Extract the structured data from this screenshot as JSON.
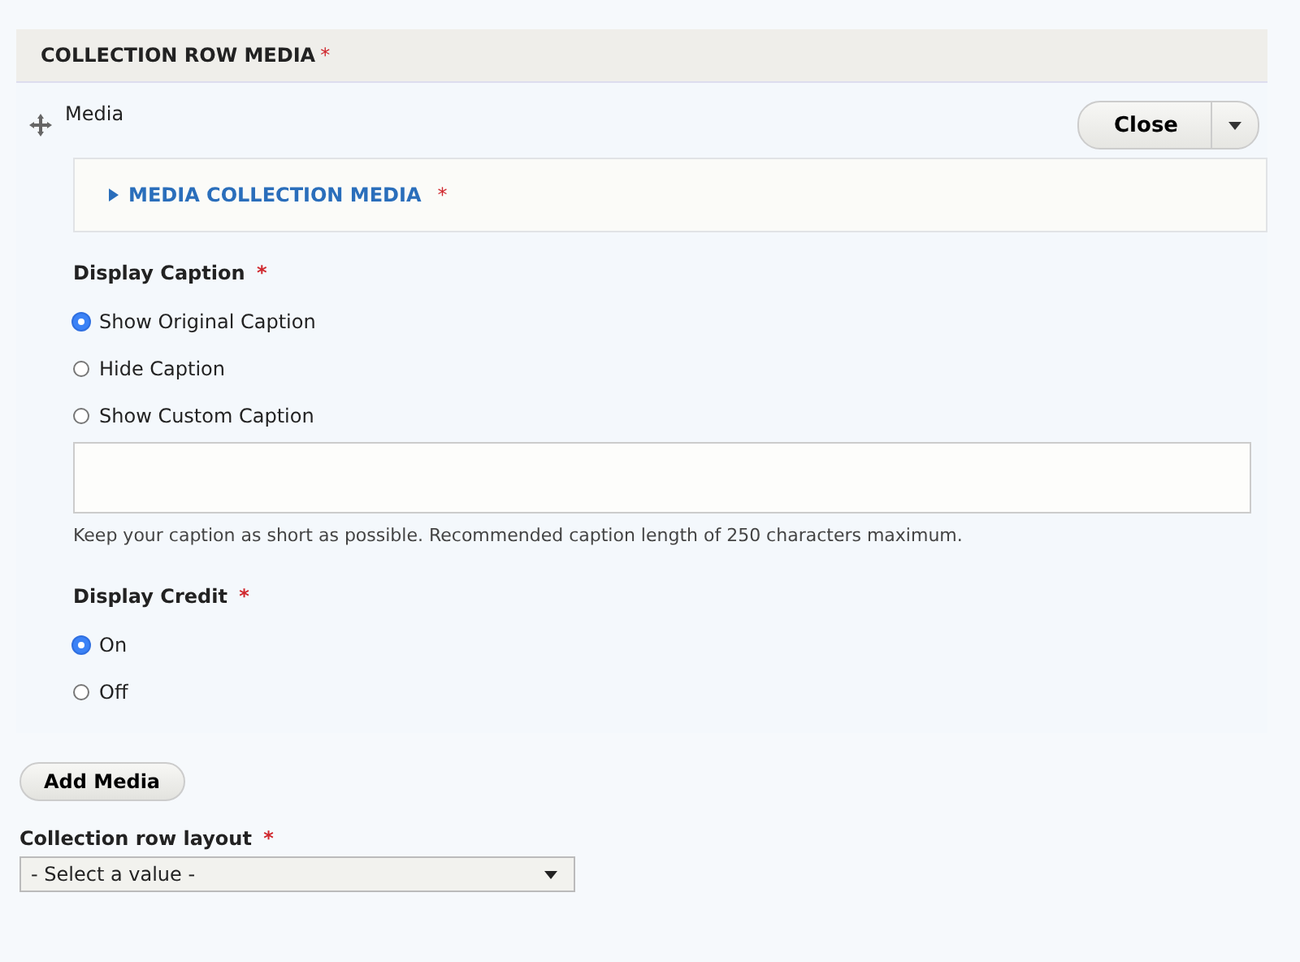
{
  "section": {
    "title": "COLLECTION ROW MEDIA",
    "required_mark": "*"
  },
  "item": {
    "label": "Media",
    "close_button": "Close",
    "details": {
      "title": "MEDIA COLLECTION MEDIA",
      "required_mark": "*",
      "expanded": false
    },
    "caption_group": {
      "label": "Display Caption",
      "required_mark": "*",
      "options": [
        {
          "label": "Show Original Caption",
          "selected": true
        },
        {
          "label": "Hide Caption",
          "selected": false
        },
        {
          "label": "Show Custom Caption",
          "selected": false
        }
      ],
      "help": "Keep your caption as short as possible. Recommended caption length of 250 characters maximum."
    },
    "credit_group": {
      "label": "Display Credit",
      "required_mark": "*",
      "options": [
        {
          "label": "On",
          "selected": true
        },
        {
          "label": "Off",
          "selected": false
        }
      ]
    }
  },
  "add_button": "Add Media",
  "layout_field": {
    "label": "Collection row layout",
    "required_mark": "*",
    "value": "- Select a value -"
  }
}
